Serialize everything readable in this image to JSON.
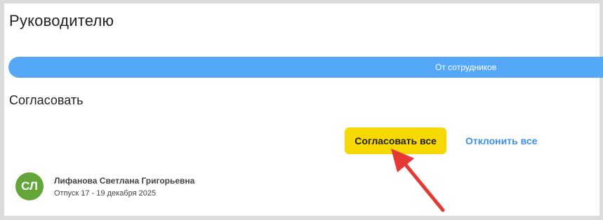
{
  "page": {
    "title": "Руководителю"
  },
  "tabs": {
    "active_label": "От сотрудников"
  },
  "section": {
    "title": "Согласовать",
    "approve_all_label": "Согласовать все",
    "reject_all_label": "Отклонить все"
  },
  "request": {
    "avatar_initials": "СЛ",
    "employee_name": "Лифанова Светлана Григорьевна",
    "details": "Отпуск 17 - 19 декабря 2025"
  },
  "colors": {
    "tab_bar": "#55a7f7",
    "approve_button": "#f7d800",
    "reject_link": "#3d8fe6",
    "avatar": "#64a53a",
    "annotation_arrow": "#e53935"
  },
  "annotation": {
    "icon": "red-arrow-icon",
    "points_to": "approve-all-button"
  }
}
